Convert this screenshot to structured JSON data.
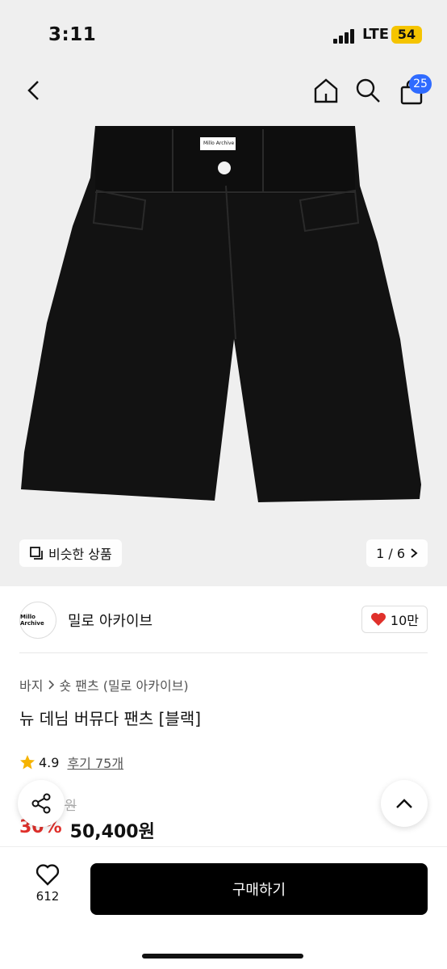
{
  "status": {
    "time": "3:11",
    "network": "LTE",
    "battery": "54"
  },
  "header": {
    "cart_count": "25"
  },
  "gallery": {
    "similar_label": "비슷한 상품",
    "page_indicator": "1 / 6",
    "label_tag": "Millo Archive"
  },
  "brand": {
    "logo_text": "Millo Archive",
    "name": "밀로 아카이브",
    "likes": "10만"
  },
  "breadcrumb": {
    "category": "바지",
    "subcategory": "숏 팬츠 (밀로 아카이브)"
  },
  "product": {
    "title": "뉴 데님 버뮤다 팬츠 [블랙]",
    "rating": "4.9",
    "reviews": "후기 75개",
    "original_price_suffix": "원",
    "discount": "30%",
    "price": "50,400원"
  },
  "bottom": {
    "wish_count": "612",
    "buy_label": "구매하기"
  },
  "colors": {
    "accent_blue": "#2f6bff",
    "discount_red": "#e0302b",
    "heart_red": "#e0302b",
    "star": "#f5b301"
  }
}
